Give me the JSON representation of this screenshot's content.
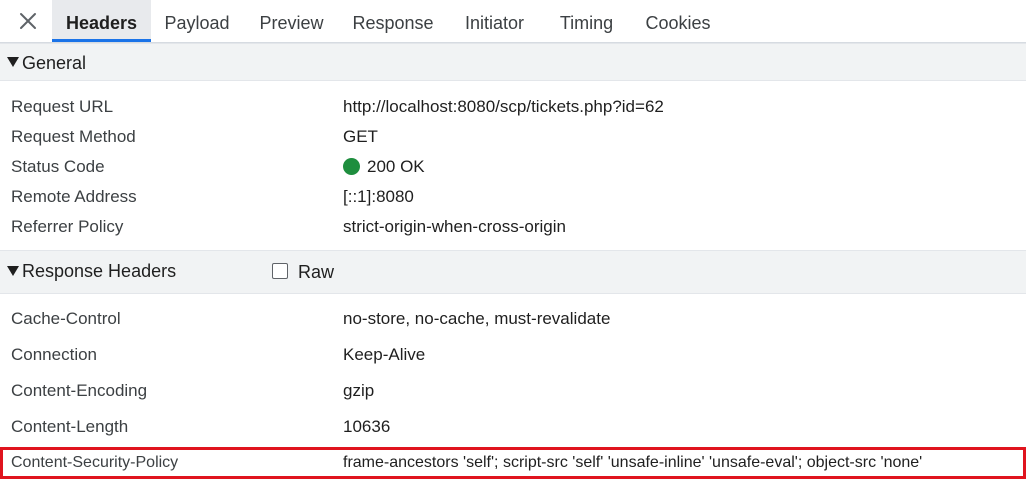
{
  "tabs": {
    "close_icon": "close-icon",
    "items": [
      {
        "label": "Headers",
        "active": true
      },
      {
        "label": "Payload"
      },
      {
        "label": "Preview"
      },
      {
        "label": "Response"
      },
      {
        "label": "Initiator"
      },
      {
        "label": "Timing"
      },
      {
        "label": "Cookies"
      }
    ]
  },
  "general": {
    "title": "General",
    "rows": [
      {
        "key": "Request URL",
        "value": "http://localhost:8080/scp/tickets.php?id=62"
      },
      {
        "key": "Request Method",
        "value": "GET"
      },
      {
        "key": "Status Code",
        "value": "200 OK",
        "status_color": "#1e8e3e"
      },
      {
        "key": "Remote Address",
        "value": "[::1]:8080"
      },
      {
        "key": "Referrer Policy",
        "value": "strict-origin-when-cross-origin"
      }
    ]
  },
  "response_headers": {
    "title": "Response Headers",
    "raw_label": "Raw",
    "raw_checked": false,
    "rows": [
      {
        "key": "Cache-Control",
        "value": "no-store, no-cache, must-revalidate"
      },
      {
        "key": "Connection",
        "value": "Keep-Alive"
      },
      {
        "key": "Content-Encoding",
        "value": "gzip"
      },
      {
        "key": "Content-Length",
        "value": "10636"
      },
      {
        "key": "Content-Security-Policy",
        "value": "frame-ancestors 'self'; script-src 'self' 'unsafe-inline' 'unsafe-eval'; object-src 'none'",
        "highlighted": true
      }
    ]
  },
  "colors": {
    "accent": "#1a73e8",
    "highlight_border": "#e0141e",
    "status_ok": "#1e8e3e"
  }
}
